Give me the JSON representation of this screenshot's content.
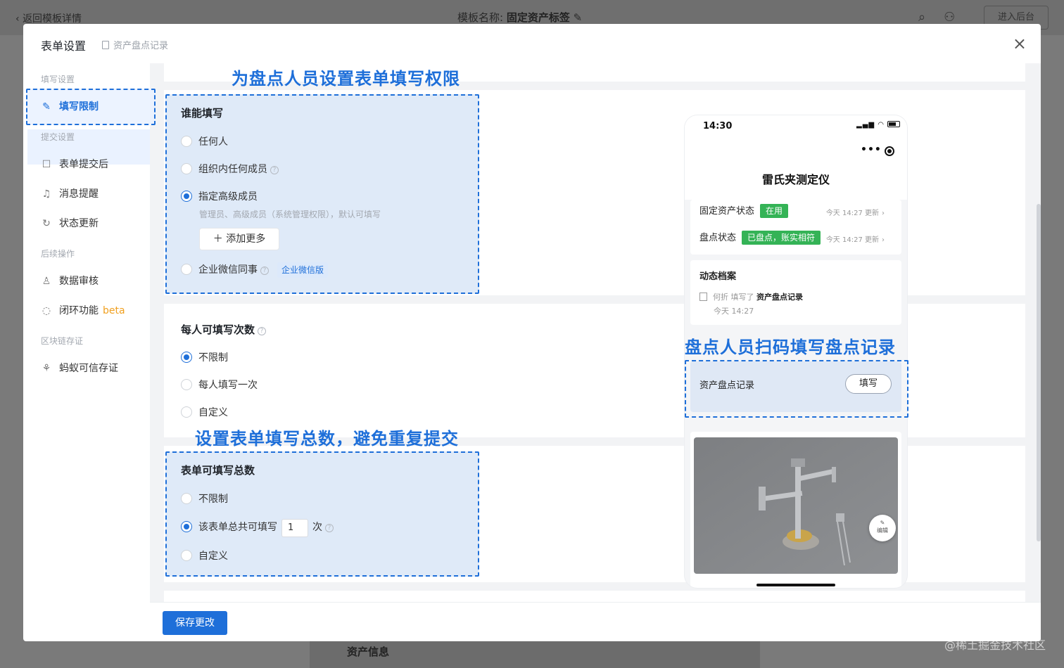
{
  "background": {
    "back_label": "返回模板详情",
    "template_prefix": "模板名称:",
    "template_name": "固定资产标签",
    "enter_admin": "进入后台",
    "bottom_section": "资产信息",
    "watermark": "@稀土掘金技术社区"
  },
  "modal": {
    "title": "表单设置",
    "subtitle": "资产盘点记录",
    "close": "×"
  },
  "sidebar": {
    "group_fill": "填写设置",
    "group_submit": "提交设置",
    "group_after": "后续操作",
    "group_chain": "区块链存证",
    "items": [
      {
        "label": "填写限制",
        "icon": "pencil-icon"
      },
      {
        "label": "表单提交后",
        "icon": "form-icon"
      },
      {
        "label": "消息提醒",
        "icon": "bell-icon"
      },
      {
        "label": "状态更新",
        "icon": "refresh-icon"
      },
      {
        "label": "数据审核",
        "icon": "stamp-icon"
      },
      {
        "label": "闭环功能",
        "icon": "loop-icon",
        "badge": "beta"
      },
      {
        "label": "蚂蚁可信存证",
        "icon": "ant-icon"
      }
    ]
  },
  "who_can_fill": {
    "title": "谁能填写",
    "options": [
      "任何人",
      "组织内任何成员",
      "指定高级成员",
      "企业微信同事"
    ],
    "selected": "指定高级成员",
    "hint": "管理员、高级成员（系统管理权限），默认可填写",
    "add_more": "添加更多",
    "wx_badge": "企业微信版"
  },
  "per_person": {
    "title": "每人可填写次数",
    "options": [
      "不限制",
      "每人填写一次",
      "自定义"
    ],
    "selected": "不限制"
  },
  "total": {
    "title": "表单可填写总数",
    "options": [
      "不限制",
      "该表单总共可填写",
      "自定义"
    ],
    "selected": "该表单总共可填写",
    "count": "1",
    "unit": "次"
  },
  "annotations": {
    "top": "为盘点人员设置表单填写权限",
    "bottom": "设置表单填写总数，避免重复提交",
    "phone": "盘点人员扫码填写盘点记录"
  },
  "save_label": "保存更改",
  "phone": {
    "time": "14:30",
    "title": "雷氏夹测定仪",
    "status_rows": [
      {
        "label": "固定资产状态",
        "tag": "在用",
        "updated": "今天 14:27 更新"
      },
      {
        "label": "盘点状态",
        "tag": "已盘点，账实相符",
        "updated": "今天 14:27 更新"
      }
    ],
    "tag_color": "#34b356",
    "dynamic_title": "动态档案",
    "log_user": "何折 填写了",
    "log_record": "资产盘点记录",
    "log_time": "今天 14:27",
    "record_label": "资产盘点记录",
    "fill_button": "填写",
    "edit_label": "编辑"
  },
  "colors": {
    "accent": "#1e6fd9",
    "highlight_fill": "#d9e6f7"
  }
}
